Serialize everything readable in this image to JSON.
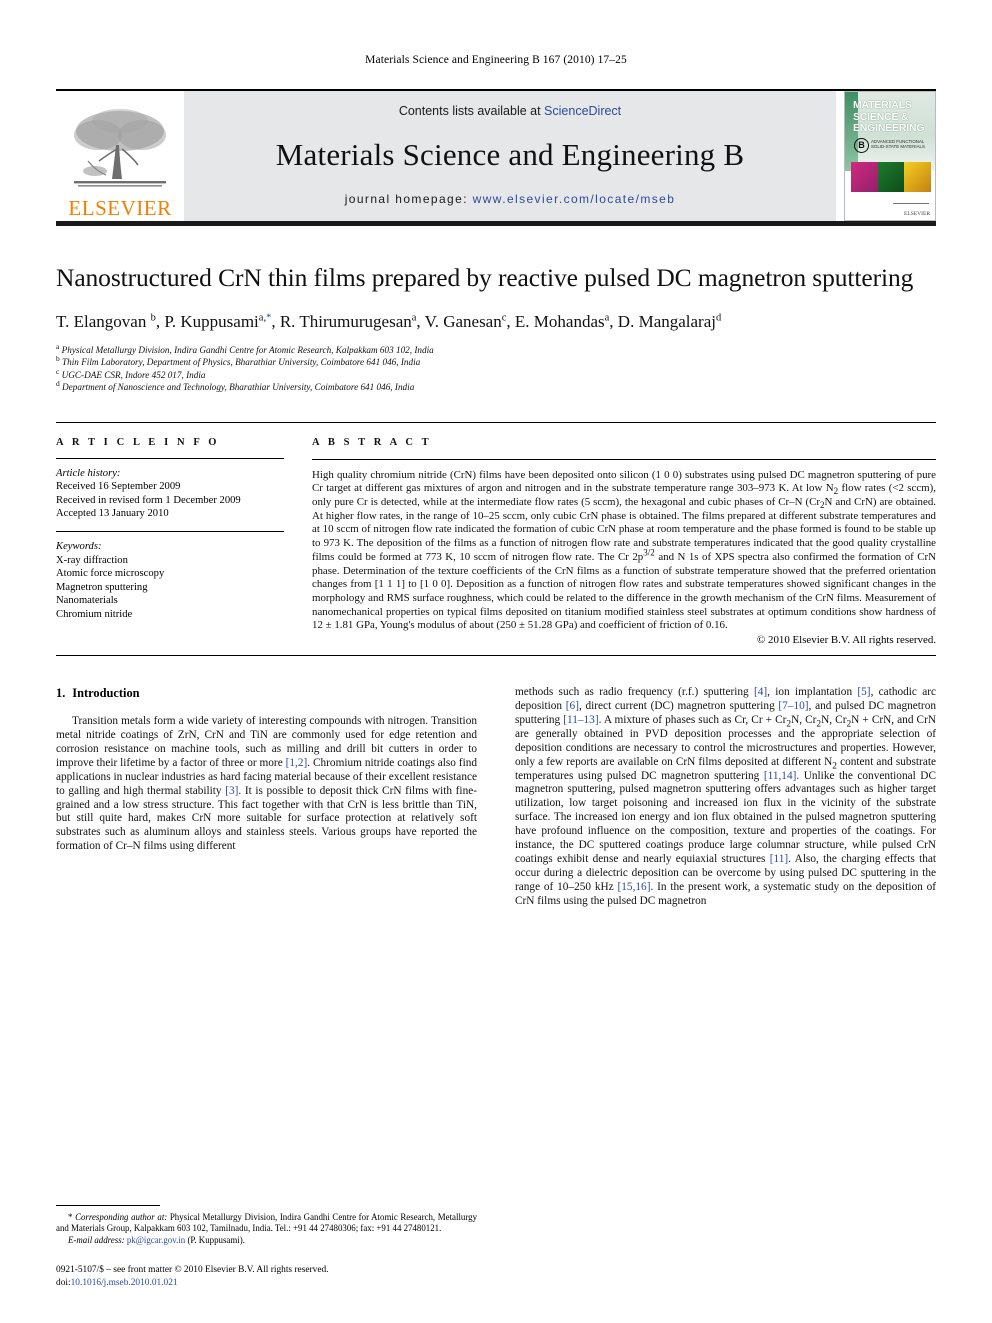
{
  "running_head": "Materials Science and Engineering B 167 (2010) 17–25",
  "masthead": {
    "publisher_name": "ELSEVIER",
    "contents_prefix": "Contents lists available at ",
    "contents_link": "ScienceDirect",
    "journal_title": "Materials Science and Engineering B",
    "homepage_prefix": "journal homepage: ",
    "homepage_url": "www.elsevier.com/locate/mseb",
    "cover": {
      "title_line1": "MATERIALS",
      "title_line2": "SCIENCE &",
      "title_line3": "ENGINEERING",
      "badge": "B",
      "subtitle": "ADVANCED FUNCTIONAL SOLID-STATE MATERIALS",
      "imprint": "ELSEVIER"
    }
  },
  "article": {
    "title": "Nanostructured CrN thin films prepared by reactive pulsed DC magnetron sputtering",
    "authors_html": "T. Elangovan <sup>b</sup>, P. Kuppusami<sup>a,</sup><sup class=\"mark\">*</sup>, R. Thirumurugesan<sup>a</sup>, V. Ganesan<sup>c</sup>, E. Mohandas<sup>a</sup>, D. Mangalaraj<sup>d</sup>",
    "affiliations": [
      {
        "marker": "a",
        "text": "Physical Metallurgy Division, Indira Gandhi Centre for Atomic Research, Kalpakkam 603 102, India"
      },
      {
        "marker": "b",
        "text": "Thin Film Laboratory, Department of Physics, Bharathiar University, Coimbatore 641 046, India"
      },
      {
        "marker": "c",
        "text": "UGC-DAE CSR, Indore 452 017, India"
      },
      {
        "marker": "d",
        "text": "Department of Nanoscience and Technology, Bharathiar University, Coimbatore 641 046, India"
      }
    ]
  },
  "article_info": {
    "heading": "A R T I C L E    I N F O",
    "history_label": "Article history:",
    "history": [
      "Received 16 September 2009",
      "Received in revised form 1 December 2009",
      "Accepted 13 January 2010"
    ],
    "keywords_label": "Keywords:",
    "keywords": [
      "X-ray diffraction",
      "Atomic force microscopy",
      "Magnetron sputtering",
      "Nanomaterials",
      "Chromium nitride"
    ]
  },
  "abstract": {
    "heading": "A B S T R A C T",
    "text_html": "High quality chromium nitride (CrN) films have been deposited onto silicon (1 0 0) substrates using pulsed DC magnetron sputtering of pure Cr target at different gas mixtures of argon and nitrogen and in the substrate temperature range 303–973 K. At low N<sub>2</sub> flow rates (&lt;2 sccm), only pure Cr is detected, while at the intermediate flow rates (5 sccm), the hexagonal and cubic phases of Cr–N (Cr<sub>2</sub>N and CrN) are obtained. At higher flow rates, in the range of 10–25 sccm, only cubic CrN phase is obtained. The films prepared at different substrate temperatures and at 10 sccm of nitrogen flow rate indicated the formation of cubic CrN phase at room temperature and the phase formed is found to be stable up to 973 K. The deposition of the films as a function of nitrogen flow rate and substrate temperatures indicated that the good quality crystalline films could be formed at 773 K, 10 sccm of nitrogen flow rate. The Cr 2p<sup>3/2</sup> and N 1s of XPS spectra also confirmed the formation of CrN phase. Determination of the texture coefficients of the CrN films as a function of substrate temperature showed that the preferred orientation changes from [1 1 1] to [1 0 0]. Deposition as a function of nitrogen flow rates and substrate temperatures showed significant changes in the morphology and RMS surface roughness, which could be related to the difference in the growth mechanism of the CrN films. Measurement of nanomechanical properties on typical films deposited on titanium modified stainless steel substrates at optimum conditions show hardness of 12 ± 1.81 GPa, Young's modulus of about (250 ± 51.28 GPa) and coefficient of friction of 0.16.",
    "copyright": "© 2010 Elsevier B.V. All rights reserved."
  },
  "introduction": {
    "number": "1.",
    "title": "Introduction",
    "left_paragraph_html": "Transition metals form a wide variety of interesting compounds with nitrogen. Transition metal nitride coatings of ZrN, CrN and TiN are commonly used for edge retention and corrosion resistance on machine tools, such as milling and drill bit cutters in order to improve their lifetime by a factor of three or more <span class=\"ref\">[1,2]</span>. Chromium nitride coatings also find applications in nuclear industries as hard facing material because of their excellent resistance to galling and high thermal stability <span class=\"ref\">[3]</span>. It is possible to deposit thick CrN films with fine-grained and a low stress structure. This fact together with that CrN is less brittle than TiN, but still quite hard, makes CrN more suitable for surface protection at relatively soft substrates such as aluminum alloys and stainless steels. Various groups have reported the formation of Cr–N films using different",
    "right_paragraph_html": "methods such as radio frequency (r.f.) sputtering <span class=\"ref\">[4]</span>, ion implantation <span class=\"ref\">[5]</span>, cathodic arc deposition <span class=\"ref\">[6]</span>, direct current (DC) magnetron sputtering <span class=\"ref\">[7–10]</span>, and pulsed DC magnetron sputtering <span class=\"ref\">[11–13]</span>. A mixture of phases such as Cr, Cr + Cr<sub>2</sub>N, Cr<sub>2</sub>N, Cr<sub>2</sub>N + CrN, and CrN are generally obtained in PVD deposition processes and the appropriate selection of deposition conditions are necessary to control the microstructures and properties. However, only a few reports are available on CrN films deposited at different N<sub>2</sub> content and substrate temperatures using pulsed DC magnetron sputtering <span class=\"ref\">[11,14]</span>. Unlike the conventional DC magnetron sputtering, pulsed magnetron sputtering offers advantages such as higher target utilization, low target poisoning and increased ion flux in the vicinity of the substrate surface. The increased ion energy and ion flux obtained in the pulsed magnetron sputtering have profound influence on the composition, texture and properties of the coatings. For instance, the DC sputtered coatings produce large columnar structure, while pulsed CrN coatings exhibit dense and nearly equiaxial structures <span class=\"ref\">[11]</span>. Also, the charging effects that occur during a dielectric deposition can be overcome by using pulsed DC sputtering in the range of 10–250 kHz <span class=\"ref\">[15,16]</span>. In the present work, a systematic study on the deposition of CrN films using the pulsed DC magnetron"
  },
  "footnote": {
    "corresponding_html": "* <i>Corresponding author at:</i> Physical Metallurgy Division, Indira Gandhi Centre for Atomic Research, Metallurgy and Materials Group, Kalpakkam 603 102, Tamilnadu, India. Tel.: +91 44 27480306; fax: +91 44 27480121.",
    "email_label": "E-mail address:",
    "email": "pk@igcar.gov.in",
    "email_owner": "(P. Kuppusami)."
  },
  "imprint": {
    "line1": "0921-5107/$ – see front matter © 2010 Elsevier B.V. All rights reserved.",
    "doi_label": "doi:",
    "doi": "10.1016/j.mseb.2010.01.021"
  },
  "colors": {
    "link_blue": "#2b4b9b",
    "elsevier_orange": "#f08000",
    "masthead_gray": "#e6e7e8"
  }
}
